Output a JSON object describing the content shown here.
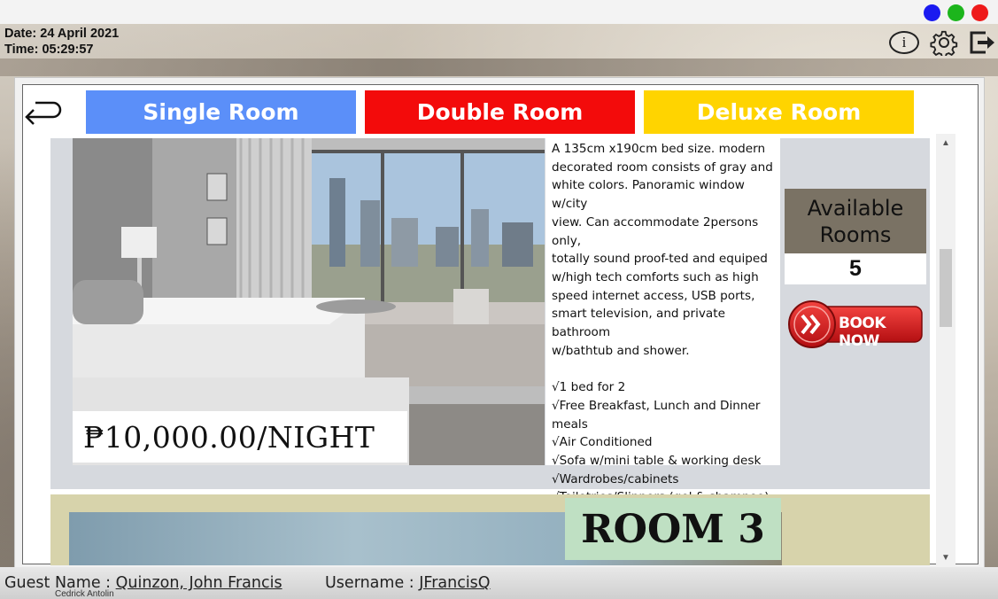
{
  "window": {
    "controls": [
      {
        "name": "minimize",
        "color": "#1a1af0"
      },
      {
        "name": "maximize",
        "color": "#1cb51c"
      },
      {
        "name": "close",
        "color": "#ee1a1a"
      }
    ]
  },
  "header": {
    "date": "Date: 24 April 2021",
    "time": "Time: 05:29:57",
    "info_label": "i"
  },
  "tabs": [
    {
      "label": "Single Room",
      "color": "#5b8ff9"
    },
    {
      "label": "Double Room",
      "color": "#f30b0b"
    },
    {
      "label": "Deluxe Room",
      "color": "#ffd400"
    }
  ],
  "room": {
    "price": "₱10,000.00/NIGHT",
    "description": [
      "A 135cm x190cm bed size. modern",
      "decorated room consists of gray and",
      "white colors. Panoramic window w/city",
      "view. Can accommodate 2persons only,",
      "totally sound proof-ted and equiped",
      "w/high tech comforts such as high",
      "speed internet access, USB ports,",
      "smart television, and private bathroom",
      "w/bathtub and shower."
    ],
    "amenities": [
      "√1 bed for 2",
      "√Free Breakfast, Lunch and Dinner",
      "meals",
      "√Air Conditioned",
      "√Sofa w/mini table & working desk",
      "√Wardrobes/cabinets",
      "√Toiletries/Slippers (gel & shampoo)"
    ],
    "available_label_1": "Available",
    "available_label_2": "Rooms",
    "available_count": "5",
    "book_label": "BOOK NOW"
  },
  "next_room": {
    "label": "ROOM 3"
  },
  "footer": {
    "guest_label": "Guest Name : ",
    "guest_value": "Quinzon, John Francis ",
    "username_label": "Username : ",
    "username_value": "JFrancisQ",
    "partial_text": "Cedrick Antolin"
  }
}
